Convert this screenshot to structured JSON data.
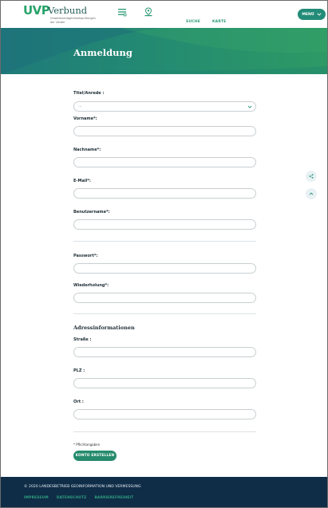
{
  "logo": {
    "brand_uvp": "UVP",
    "brand_verbund": "Verbund",
    "sub1": "Umweltverträglichkeitsprüfungen",
    "sub2": "der Länder"
  },
  "nav": {
    "suche": "SUCHE",
    "karte": "KARTE",
    "menu": "MENÜ"
  },
  "page": {
    "title": "Anmeldung"
  },
  "form": {
    "title_label": "Titel/Anrede :",
    "title_value": "...",
    "vorname_label": "Vorname*:",
    "nachname_label": "Nachname*:",
    "email_label": "E-Mail*:",
    "benutzername_label": "Benutzername*:",
    "passwort_label": "Passwort*:",
    "wiederholung_label": "Wiederholung*:",
    "address_section_title": "Adressinformationen",
    "strasse_label": "Straße :",
    "plz_label": "PLZ :",
    "ort_label": "Ort :",
    "required_note": "* Pflichtangaben",
    "submit_label": "KONTO ERSTELLEN"
  },
  "footer": {
    "copyright": "© 2020 LANDESBETRIEB GEOINFORMATION UND VERMESSUNG",
    "links": [
      "IMPRESSUM",
      "DATENSCHUTZ",
      "BARRIEREFREIHEIT"
    ]
  },
  "colors": {
    "accent": "#258b6c",
    "hero_start": "#1f7a7a",
    "hero_end": "#2d9a65",
    "footer": "#0f2d47"
  },
  "icons": {
    "search": "search-icon",
    "map": "map-icon",
    "menu_chevron": "chevron-down-icon",
    "share": "share-icon",
    "back_to_top": "chevron-up-icon"
  }
}
